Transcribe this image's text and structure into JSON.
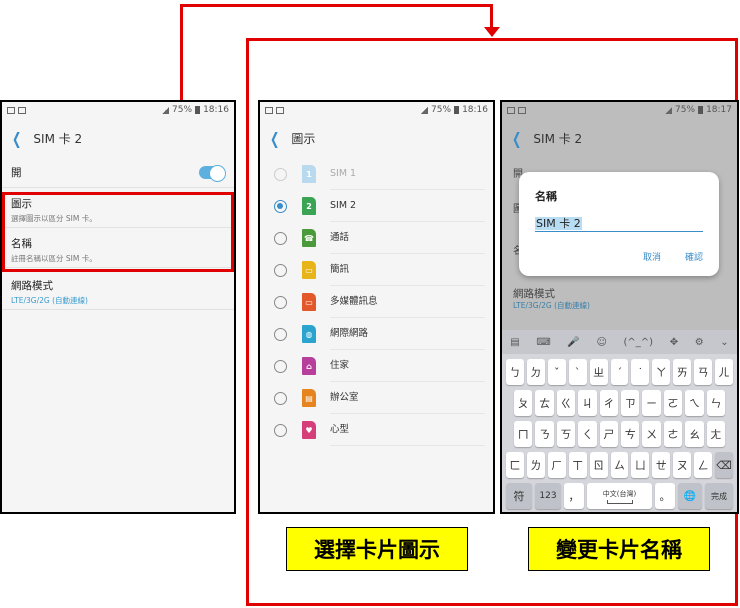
{
  "status_bar": {
    "battery": "75%",
    "time": "18:16",
    "time_right": "18:17"
  },
  "phone1": {
    "title": "SIM 卡 2",
    "toggle_label": "開",
    "rows": [
      {
        "title": "圖示",
        "sub": "選擇圖示以區分 SIM 卡。"
      },
      {
        "title": "名稱",
        "sub": "註冊名稱以區分 SIM 卡。"
      },
      {
        "title": "網路模式",
        "sub": "LTE/3G/2G (自動連線)"
      }
    ]
  },
  "phone2": {
    "title": "圖示",
    "items": [
      {
        "label": "SIM 1",
        "icon_text": "1",
        "color": "#b9d9ee",
        "state": "disabled"
      },
      {
        "label": "SIM 2",
        "icon_text": "2",
        "color": "#3aa354",
        "state": "selected"
      },
      {
        "label": "通話",
        "icon_text": "☎",
        "color": "#4a9a3c",
        "state": ""
      },
      {
        "label": "簡訊",
        "icon_text": "▭",
        "color": "#e7b419",
        "state": ""
      },
      {
        "label": "多媒體訊息",
        "icon_text": "▭",
        "color": "#e2582a",
        "state": ""
      },
      {
        "label": "網際網路",
        "icon_text": "◍",
        "color": "#2aa4cf",
        "state": ""
      },
      {
        "label": "住家",
        "icon_text": "⌂",
        "color": "#b83e9c",
        "state": ""
      },
      {
        "label": "辦公室",
        "icon_text": "▤",
        "color": "#e6841f",
        "state": ""
      },
      {
        "label": "心型",
        "icon_text": "♥",
        "color": "#d63e7a",
        "state": ""
      }
    ]
  },
  "phone3": {
    "title": "SIM 卡 2",
    "dialog": {
      "title": "名稱",
      "value": "SIM 卡 2",
      "cancel": "取消",
      "confirm": "確認"
    },
    "bg_rows": [
      "開",
      "圖",
      "名",
      "網路模式",
      "LTE/3G/2G (自動連線)"
    ],
    "keyboard": {
      "row1": [
        "ㄅ",
        "ㄉ",
        "ˇ",
        "ˋ",
        "ㄓ",
        "ˊ",
        "˙",
        "ㄚ",
        "ㄞ",
        "ㄢ",
        "ㄦ"
      ],
      "row2": [
        "ㄆ",
        "ㄊ",
        "ㄍ",
        "ㄐ",
        "ㄔ",
        "ㄗ",
        "ㄧ",
        "ㄛ",
        "ㄟ",
        "ㄣ"
      ],
      "row3": [
        "ㄇ",
        "ㄋ",
        "ㄎ",
        "ㄑ",
        "ㄕ",
        "ㄘ",
        "ㄨ",
        "ㄜ",
        "ㄠ",
        "ㄤ"
      ],
      "row4": [
        "ㄈ",
        "ㄌ",
        "ㄏ",
        "ㄒ",
        "ㄖ",
        "ㄙ",
        "ㄩ",
        "ㄝ",
        "ㄡ",
        "ㄥ",
        "⌫"
      ],
      "bottom": {
        "symbol": "符",
        "numbers": "123",
        "comma": "，",
        "space": "中文(台灣)",
        "period": "。",
        "globe": "🌐",
        "done": "完成"
      },
      "toolbar": [
        "▤",
        "⌨",
        "🎤",
        "☺",
        "(^_^)",
        "✥",
        "⚙",
        "⌄"
      ]
    }
  },
  "captions": {
    "left": "選擇卡片圖示",
    "right": "變更卡片名稱"
  },
  "colors": {
    "highlight": "#e00000",
    "accent": "#3a8dc8",
    "caption_bg": "#ffff00"
  }
}
